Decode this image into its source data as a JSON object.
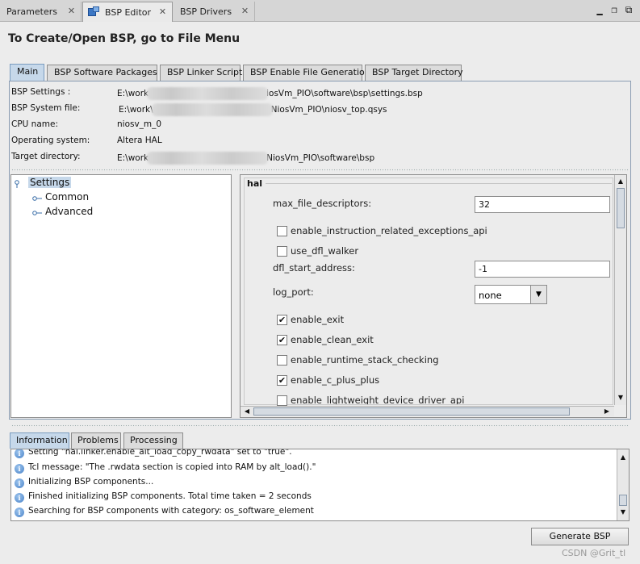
{
  "window": {
    "tabs": [
      {
        "label": "Parameters",
        "active": false
      },
      {
        "label": "BSP Editor",
        "active": true
      },
      {
        "label": "BSP Drivers",
        "active": false
      }
    ],
    "controls": {
      "minimize": "▁",
      "restore": "❐",
      "maximize": "⧉"
    }
  },
  "page": {
    "title": "To Create/Open BSP, go to File Menu"
  },
  "main_tabs": [
    "Main",
    "BSP Software Packages",
    "BSP Linker Script",
    "BSP Enable File Generation",
    "BSP Target Directory"
  ],
  "info": [
    {
      "label": "BSP Settings :",
      "value_prefix": "E:\\work",
      "value_suffix": "iosVm_PIO\\software\\bsp\\settings.bsp"
    },
    {
      "label": "BSP System file:",
      "value_prefix": "E:\\work\\",
      "value_suffix": "NiosVm_PIO\\niosv_top.qsys"
    },
    {
      "label": "CPU name:",
      "value": "niosv_m_0"
    },
    {
      "label": "Operating system:",
      "value": "Altera HAL"
    },
    {
      "label": "Target directory:",
      "value_prefix": "E:\\work",
      "value_suffix": "NiosVm_PIO\\software\\bsp"
    }
  ],
  "tree": {
    "root": "Settings",
    "children": [
      "Common",
      "Advanced"
    ]
  },
  "settings": {
    "group": "hal",
    "max_file_descriptors": {
      "label": "max_file_descriptors:",
      "value": "32"
    },
    "checks_a": [
      {
        "label": "enable_instruction_related_exceptions_api",
        "checked": false
      },
      {
        "label": "use_dfl_walker",
        "checked": false
      }
    ],
    "dfl_start_address": {
      "label": "dfl_start_address:",
      "value": "-1"
    },
    "log_port": {
      "label": "log_port:",
      "value": "none"
    },
    "checks_b": [
      {
        "label": "enable_exit",
        "checked": true
      },
      {
        "label": "enable_clean_exit",
        "checked": true
      },
      {
        "label": "enable_runtime_stack_checking",
        "checked": false
      },
      {
        "label": "enable_c_plus_plus",
        "checked": true
      },
      {
        "label": "enable_lightweight_device_driver_api",
        "checked": false
      }
    ]
  },
  "bottom_tabs": [
    "Information",
    "Problems",
    "Processing"
  ],
  "messages": [
    "Setting \"hal.linker.enable_alt_load_copy_rwdata\" set to \"true\".",
    "Tcl message: \"The .rwdata section is copied into RAM by alt_load().\"",
    "Initializing BSP components...",
    "Finished initializing BSP components. Total time taken = 2 seconds",
    "Searching for BSP components with category: os_software_element"
  ],
  "generate_button": "Generate BSP",
  "watermark": "CSDN @Grit_tl",
  "glyphs": {
    "check": "✔",
    "up": "▲",
    "down": "▼",
    "left": "◀",
    "right": "▶",
    "info": "i",
    "close": "✕"
  }
}
